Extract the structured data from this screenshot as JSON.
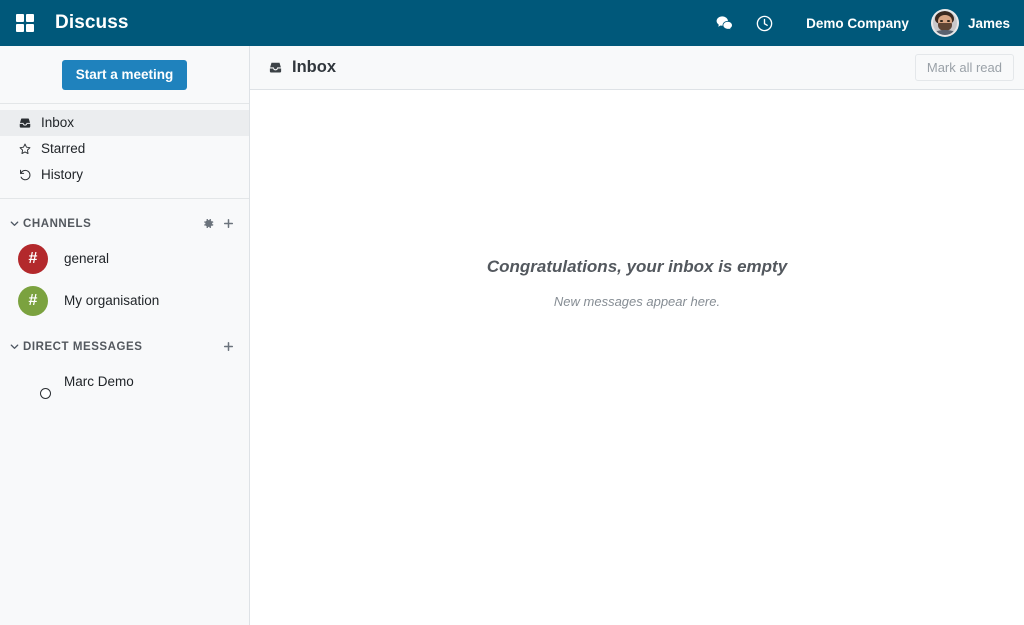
{
  "navbar": {
    "apps_icon": "grid-apps-icon",
    "brand": "Discuss",
    "messages_icon": "chat-bubbles-icon",
    "activities_icon": "clock-icon",
    "company": "Demo Company",
    "user": "James",
    "background_color": "#00587a"
  },
  "sidebar": {
    "start_meeting_label": "Start a meeting",
    "start_meeting_color": "#1f82bd",
    "nav_items": [
      {
        "label": "Inbox",
        "icon": "inbox-tray-icon",
        "active": true
      },
      {
        "label": "Starred",
        "icon": "star-outline-icon",
        "active": false
      },
      {
        "label": "History",
        "icon": "history-undo-icon",
        "active": false
      }
    ],
    "channels_section": {
      "title": "CHANNELS",
      "caret_icon": "chevron-down-icon",
      "gear_icon": "gear-icon",
      "add_icon": "plus-icon",
      "items": [
        {
          "label": "general",
          "glyph": "#",
          "color": "#b3292c"
        },
        {
          "label": "My organisation",
          "glyph": "#",
          "color": "#7ba23f"
        }
      ]
    },
    "direct_messages_section": {
      "title": "DIRECT MESSAGES",
      "caret_icon": "chevron-down-icon",
      "add_icon": "plus-icon",
      "items": [
        {
          "label": "Marc Demo",
          "status": "offline"
        }
      ]
    }
  },
  "main": {
    "header": {
      "icon": "inbox-tray-icon",
      "title": "Inbox",
      "mark_all_read_label": "Mark all read"
    },
    "empty_state": {
      "title": "Congratulations, your inbox is empty",
      "subtitle": "New messages appear here."
    }
  }
}
